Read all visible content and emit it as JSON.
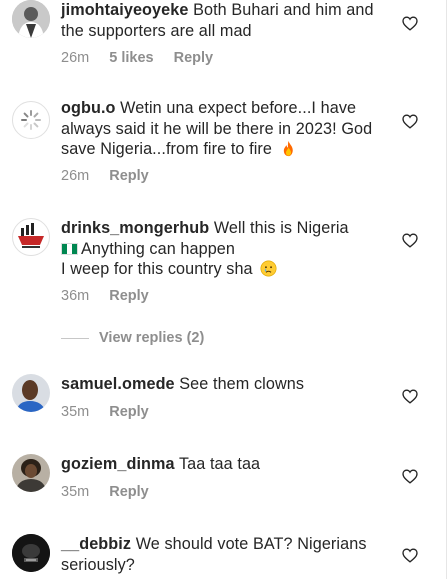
{
  "comments": [
    {
      "username": "jimohtaiyeoyeke",
      "text": "Both Buhari and him and the supporters are all mad",
      "time": "26m",
      "likes": "5 likes",
      "reply": "Reply",
      "avatar_icon": "person-silhouette-icon"
    },
    {
      "username": "ogbu.o",
      "text": "Wetin una expect before...I have always said it he will be there in 2023! God save Nigeria...from fire to fire",
      "emoji": "fire-emoji",
      "time": "26m",
      "reply": "Reply",
      "avatar_icon": "loading-spinner-icon"
    },
    {
      "username": "drinks_mongerhub",
      "text": "Well this is Nigeria",
      "text2": "Anything can happen",
      "text3": "I weep for this country sha",
      "flag_icon": "nigeria-flag-icon",
      "emoji": "crying-face-emoji",
      "time": "36m",
      "reply": "Reply",
      "avatar_icon": "drinks-monger-logo-icon"
    },
    {
      "username": "samuel.omede",
      "text": "See them clowns",
      "time": "35m",
      "reply": "Reply",
      "avatar_icon": "man-photo-icon"
    },
    {
      "username": "goziem_dinma",
      "text": "Taa taa taa",
      "time": "35m",
      "reply": "Reply",
      "avatar_icon": "woman-photo-icon"
    },
    {
      "username": "__debbiz",
      "text": "We should vote BAT? Nigerians seriously?",
      "avatar_icon": "dark-logo-icon"
    }
  ],
  "view_replies": "View replies (2)",
  "colors": {
    "text": "#262626",
    "secondary": "#8e8e8e",
    "fire": "#ff6a00"
  }
}
